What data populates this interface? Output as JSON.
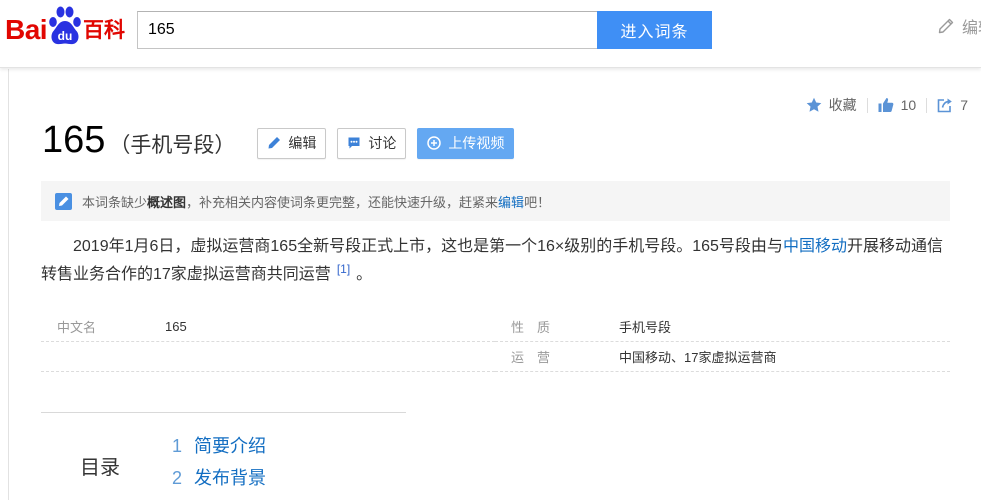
{
  "header": {
    "logo": {
      "bai": "Bai",
      "du": "du",
      "baike": "百科"
    },
    "search": {
      "value": "165"
    },
    "enter_button": "进入词条",
    "edit_label": "编辑"
  },
  "actions": {
    "collect_label": "收藏",
    "like_count": "10",
    "share_count": "7"
  },
  "title": {
    "main": "165",
    "sub": "（手机号段）"
  },
  "title_buttons": {
    "edit": "编辑",
    "discuss": "讨论",
    "upload_video": "上传视频"
  },
  "notice": {
    "prefix": "本词条缺少",
    "bold": "概述图",
    "middle": "，补充相关内容使词条更完整，还能快速升级，赶紧来",
    "link": "编辑",
    "suffix": "吧！"
  },
  "summary": {
    "text_before_link": "2019年1月6日，虚拟运营商165全新号段正式上市，这也是第一个16×级别的手机号段。165号段由与",
    "link": "中国移动",
    "text_after_link": "开展移动通信转售业务合作的17家虚拟运营商共同运营",
    "ref": "[1]",
    "end": "。"
  },
  "basic_info": {
    "left": [
      {
        "name": "中文名",
        "value": "165"
      }
    ],
    "right": [
      {
        "name": "性　质",
        "value": "手机号段"
      },
      {
        "name": "运　营",
        "value": "中国移动、17家虚拟运营商"
      }
    ]
  },
  "catalog": {
    "title": "目录",
    "items": [
      {
        "num": "1",
        "label": "简要介绍"
      },
      {
        "num": "2",
        "label": "发布背景"
      }
    ]
  },
  "icons": {
    "logo": "paw-icon",
    "header_edit": "pencil-icon",
    "collect": "star-icon",
    "like": "thumbs-up-icon",
    "share": "share-icon",
    "title_edit": "pencil-icon",
    "discuss": "chat-icon",
    "upload_video": "plus-circle-icon",
    "notice": "edit-notice-icon"
  },
  "colors": {
    "brand_red": "#e10601",
    "brand_blue": "#2932e1",
    "primary": "#3f8ff5",
    "link": "#136ec2",
    "icon_blue": "#5b93d6",
    "upload_blue": "#64a8f2"
  }
}
